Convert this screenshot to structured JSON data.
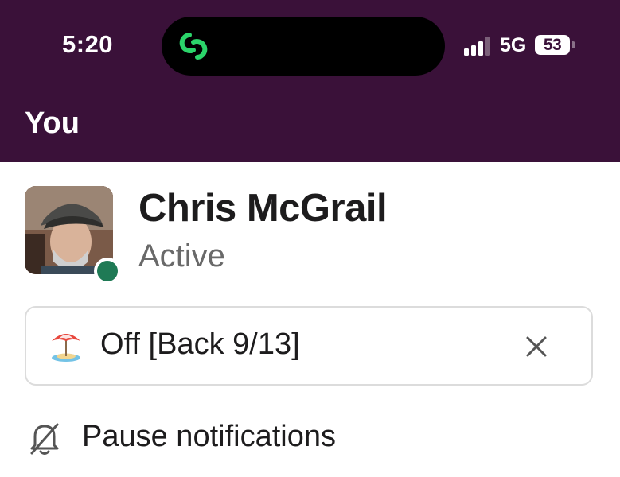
{
  "status_bar": {
    "time": "5:20",
    "network": "5G",
    "battery": "53",
    "island_icon": "link-rings-icon"
  },
  "header": {
    "title": "You"
  },
  "profile": {
    "name": "Chris McGrail",
    "presence": "Active",
    "presence_color": "#1f7a55"
  },
  "custom_status": {
    "emoji_icon": "beach-umbrella-icon",
    "text": "Off [Back 9/13]",
    "clear_icon": "close-icon"
  },
  "menu": [
    {
      "label": "Pause notifications",
      "icon": "bell-slash-icon"
    }
  ],
  "colors": {
    "header_bg": "#3a1139",
    "accent_green": "#2bd46a"
  }
}
